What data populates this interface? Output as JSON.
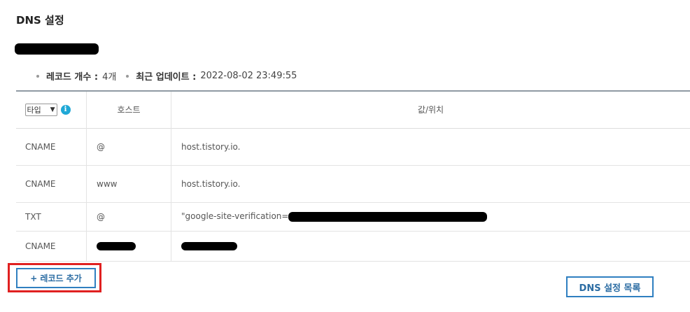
{
  "page": {
    "title": "DNS 설정"
  },
  "summary": {
    "record_count_label": "레코드 개수 :",
    "record_count_value": "4개",
    "last_update_label": "최근 업데이트 :",
    "last_update_value": "2022-08-02 23:49:55"
  },
  "table": {
    "type_filter": {
      "selected": "타입",
      "info_icon": "info-icon"
    },
    "headers": {
      "host": "호스트",
      "value": "값/위치"
    },
    "rows": [
      {
        "type": "CNAME",
        "host": "@",
        "value": "host.tistory.io."
      },
      {
        "type": "CNAME",
        "host": "www",
        "value": "host.tistory.io."
      },
      {
        "type": "TXT",
        "host": "@",
        "value": "\"google-site-verification="
      },
      {
        "type": "CNAME",
        "host": "",
        "value": ""
      }
    ]
  },
  "buttons": {
    "add_record": "+ 레코드 추가",
    "dns_list": "DNS 설정 목록"
  },
  "colors": {
    "button_border": "#2f7fc0",
    "highlight": "#e02020",
    "info_icon": "#1fa8d6",
    "table_top_border": "#8f9aa3"
  }
}
